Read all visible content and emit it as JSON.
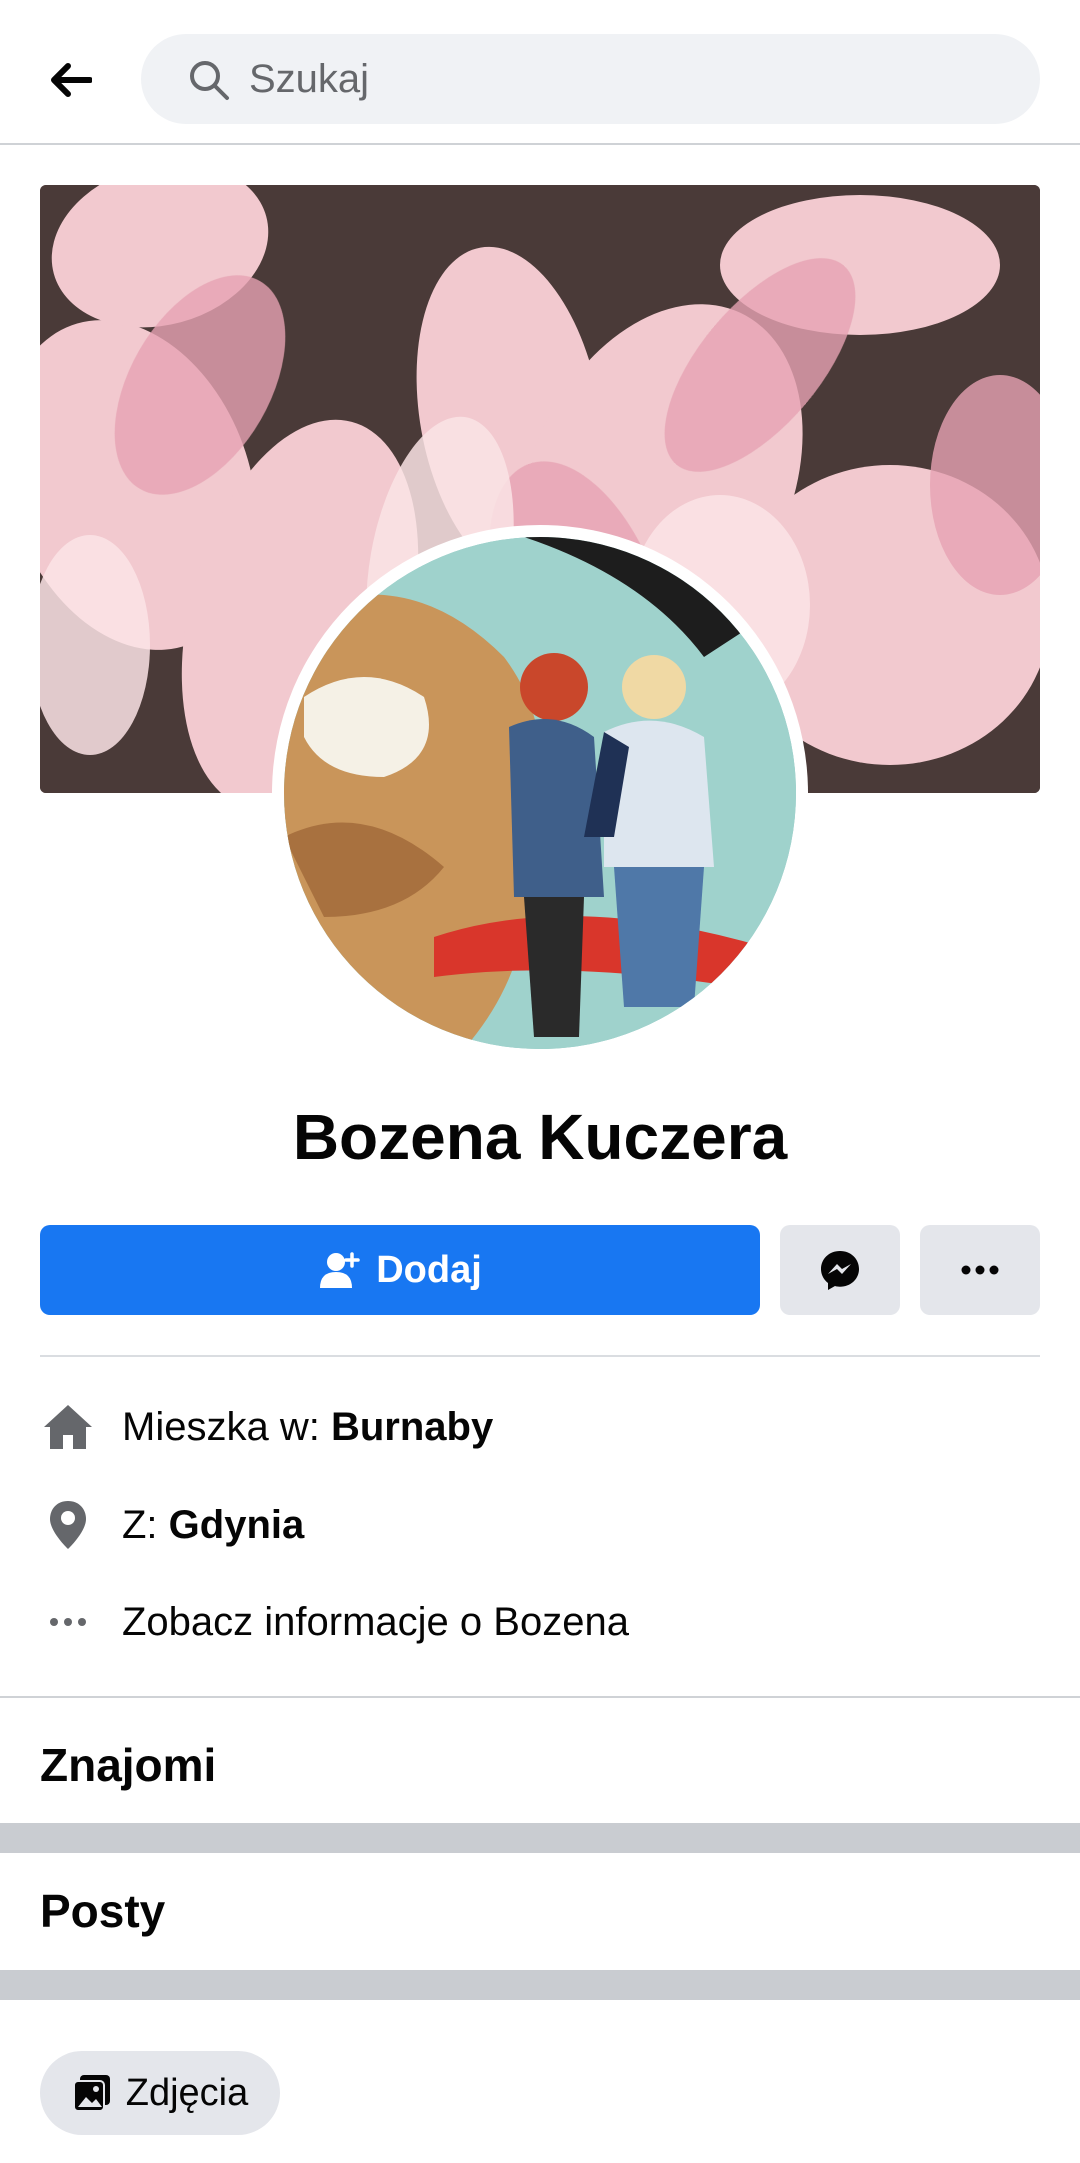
{
  "search": {
    "placeholder": "Szukaj"
  },
  "profile": {
    "name": "Bozena Kuczera"
  },
  "actions": {
    "add_label": "Dodaj"
  },
  "intro": {
    "lives_prefix": "Mieszka w: ",
    "lives_value": "Burnaby",
    "from_prefix": "Z: ",
    "from_value": "Gdynia",
    "see_about": "Zobacz informacje o Bozena"
  },
  "sections": {
    "friends": "Znajomi",
    "posts": "Posty"
  },
  "chips": {
    "photos": "Zdjęcia"
  },
  "colors": {
    "accent": "#1877f2",
    "secondary_button": "#e4e6eb",
    "divider": "#c9ccd1"
  },
  "icons": [
    "back-arrow-icon",
    "search-icon",
    "add-friend-icon",
    "messenger-icon",
    "more-icon",
    "home-icon",
    "location-pin-icon",
    "more-dots-icon",
    "photos-icon"
  ]
}
